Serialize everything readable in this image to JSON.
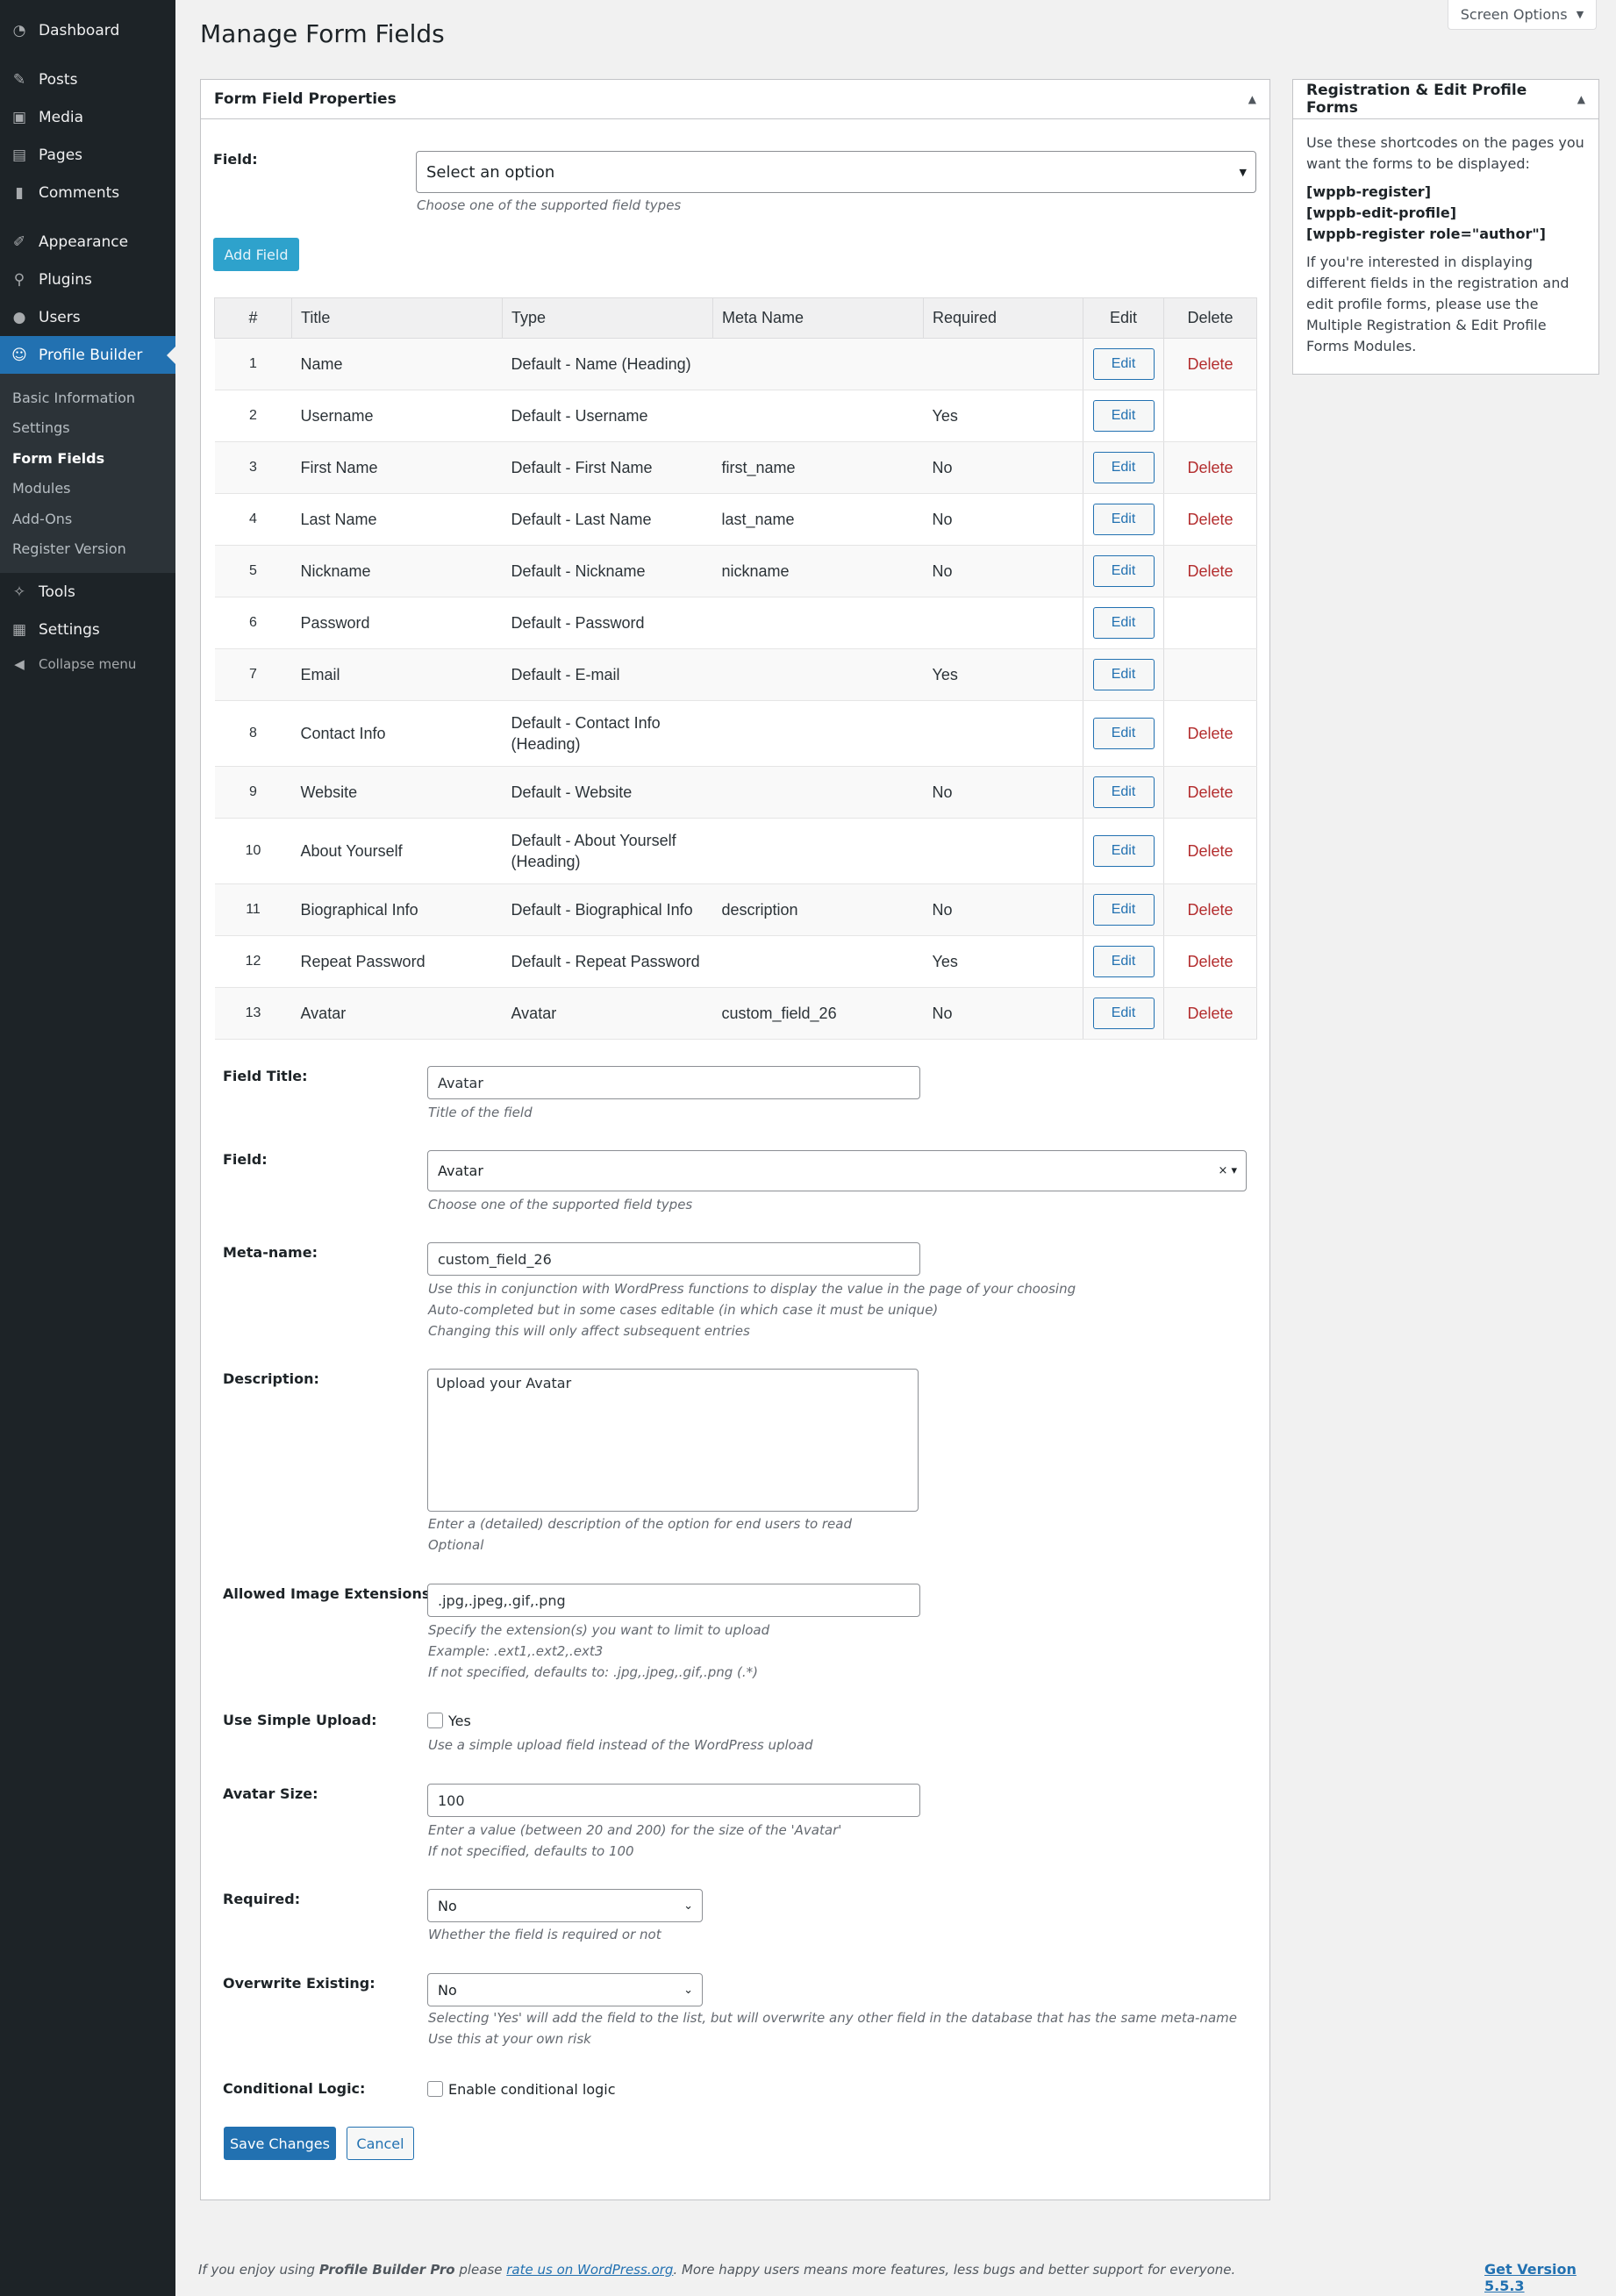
{
  "sidebar": {
    "items": [
      {
        "label": "Dashboard",
        "icon": "dashboard-icon"
      },
      {
        "label": "Posts",
        "icon": "pin-icon"
      },
      {
        "label": "Media",
        "icon": "media-icon"
      },
      {
        "label": "Pages",
        "icon": "pages-icon"
      },
      {
        "label": "Comments",
        "icon": "comment-icon"
      },
      {
        "label": "Appearance",
        "icon": "brush-icon"
      },
      {
        "label": "Plugins",
        "icon": "plug-icon"
      },
      {
        "label": "Users",
        "icon": "user-icon"
      },
      {
        "label": "Profile Builder",
        "icon": "profile-builder-icon"
      },
      {
        "label": "Tools",
        "icon": "wrench-icon"
      },
      {
        "label": "Settings",
        "icon": "settings-icon"
      },
      {
        "label": "Collapse menu",
        "icon": "collapse-icon"
      }
    ],
    "submenu": [
      "Basic Information",
      "Settings",
      "Form Fields",
      "Modules",
      "Add-Ons",
      "Register Version"
    ]
  },
  "screen_options": "Screen Options",
  "page_title": "Manage Form Fields",
  "main_box": {
    "title": "Form Field Properties",
    "field_label": "Field:",
    "field_placeholder": "Select an option",
    "field_hint": "Choose one of the supported field types",
    "add_button": "Add Field"
  },
  "table": {
    "headers": [
      "#",
      "Title",
      "Type",
      "Meta Name",
      "Required",
      "Edit",
      "Delete"
    ],
    "rows": [
      {
        "n": "1",
        "title": "Name",
        "type": "Default - Name (Heading)",
        "meta": "",
        "req": "",
        "edit": "Edit",
        "del": "Delete"
      },
      {
        "n": "2",
        "title": "Username",
        "type": "Default - Username",
        "meta": "",
        "req": "Yes",
        "edit": "Edit",
        "del": ""
      },
      {
        "n": "3",
        "title": "First Name",
        "type": "Default - First Name",
        "meta": "first_name",
        "req": "No",
        "edit": "Edit",
        "del": "Delete"
      },
      {
        "n": "4",
        "title": "Last Name",
        "type": "Default - Last Name",
        "meta": "last_name",
        "req": "No",
        "edit": "Edit",
        "del": "Delete"
      },
      {
        "n": "5",
        "title": "Nickname",
        "type": "Default - Nickname",
        "meta": "nickname",
        "req": "No",
        "edit": "Edit",
        "del": "Delete"
      },
      {
        "n": "6",
        "title": "Password",
        "type": "Default - Password",
        "meta": "",
        "req": "",
        "edit": "Edit",
        "del": ""
      },
      {
        "n": "7",
        "title": "Email",
        "type": "Default - E-mail",
        "meta": "",
        "req": "Yes",
        "edit": "Edit",
        "del": ""
      },
      {
        "n": "8",
        "title": "Contact Info",
        "type": "Default - Contact Info (Heading)",
        "meta": "",
        "req": "",
        "edit": "Edit",
        "del": "Delete"
      },
      {
        "n": "9",
        "title": "Website",
        "type": "Default - Website",
        "meta": "",
        "req": "No",
        "edit": "Edit",
        "del": "Delete"
      },
      {
        "n": "10",
        "title": "About Yourself",
        "type": "Default - About Yourself (Heading)",
        "meta": "",
        "req": "",
        "edit": "Edit",
        "del": "Delete"
      },
      {
        "n": "11",
        "title": "Biographical Info",
        "type": "Default - Biographical Info",
        "meta": "description",
        "req": "No",
        "edit": "Edit",
        "del": "Delete"
      },
      {
        "n": "12",
        "title": "Repeat Password",
        "type": "Default - Repeat Password",
        "meta": "",
        "req": "Yes",
        "edit": "Edit",
        "del": "Delete"
      },
      {
        "n": "13",
        "title": "Avatar",
        "type": "Avatar",
        "meta": "custom_field_26",
        "req": "No",
        "edit": "Edit",
        "del": "Delete"
      }
    ]
  },
  "editor": {
    "field_title": {
      "label": "Field Title:",
      "value": "Avatar",
      "hint": "Title of the field"
    },
    "field": {
      "label": "Field:",
      "value": "Avatar",
      "hint": "Choose one of the supported field types"
    },
    "meta_name": {
      "label": "Meta-name:",
      "value": "custom_field_26",
      "hint1": "Use this in conjunction with WordPress functions to display the value in the page of your choosing",
      "hint2": "Auto-completed but in some cases editable (in which case it must be unique)",
      "hint3": "Changing this will only affect subsequent entries"
    },
    "description": {
      "label": "Description:",
      "value": "Upload your Avatar",
      "hint1": "Enter a (detailed) description of the option for end users to read",
      "hint2": "Optional"
    },
    "extensions": {
      "label": "Allowed Image Extensions:",
      "value": ".jpg,.jpeg,.gif,.png",
      "hint1": "Specify the extension(s) you want to limit to upload",
      "hint2": "Example: .ext1,.ext2,.ext3",
      "hint3": "If not specified, defaults to: .jpg,.jpeg,.gif,.png (.*)"
    },
    "simple_upload": {
      "label": "Use Simple Upload:",
      "option": "Yes",
      "hint": "Use a simple upload field instead of the WordPress upload"
    },
    "avatar_size": {
      "label": "Avatar Size:",
      "value": "100",
      "hint1": "Enter a value (between 20 and 200) for the size of the 'Avatar'",
      "hint2": "If not specified, defaults to 100"
    },
    "required": {
      "label": "Required:",
      "value": "No",
      "hint": "Whether the field is required or not"
    },
    "overwrite": {
      "label": "Overwrite Existing:",
      "value": "No",
      "hint1": "Selecting 'Yes' will add the field to the list, but will overwrite any other field in the database that has the same meta-name",
      "hint2": "Use this at your own risk"
    },
    "conditional": {
      "label": "Conditional Logic:",
      "option": "Enable conditional logic"
    },
    "save": "Save Changes",
    "cancel": "Cancel"
  },
  "side_box": {
    "title": "Registration & Edit Profile Forms",
    "intro": "Use these shortcodes on the pages you want the forms to be displayed:",
    "sc1": "[wppb-register]",
    "sc2": "[wppb-edit-profile]",
    "sc3": "[wppb-register role=\"author\"]",
    "note": "If you're interested in displaying different fields in the registration and edit profile forms, please use the Multiple Registration & Edit Profile Forms Modules."
  },
  "footer": {
    "pre": "If you enjoy using ",
    "product": "Profile Builder Pro",
    "mid": " please ",
    "link": "rate us on WordPress.org",
    "post": ". More happy users means more features, less bugs and better support for everyone.",
    "version": "Get Version 5.5.3"
  }
}
